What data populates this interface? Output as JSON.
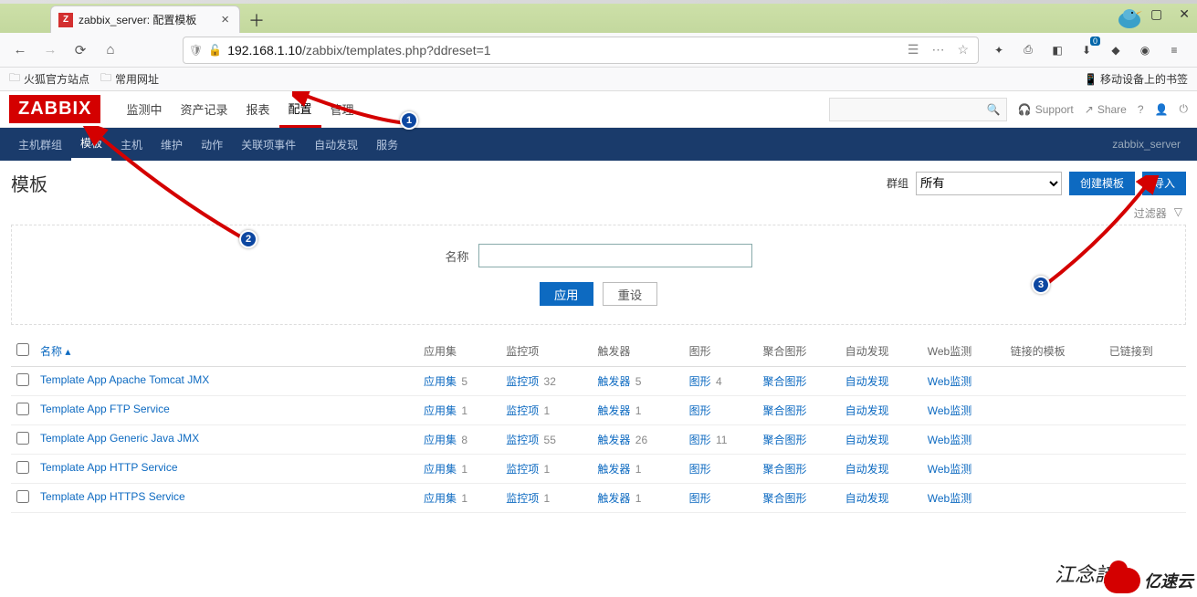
{
  "browser": {
    "tab_title": "zabbix_server: 配置模板",
    "url_display_prefix": "192.168.1.10",
    "url_display_path": "/zabbix/templates.php?ddreset=1",
    "bookmarks": {
      "b1": "火狐官方站点",
      "b2": "常用网址",
      "right": "移动设备上的书签"
    },
    "download_badge": "0"
  },
  "zabbix": {
    "logo": "ZABBIX",
    "main_menu": [
      "监测中",
      "资产记录",
      "报表",
      "配置",
      "管理"
    ],
    "main_menu_active_idx": 3,
    "top_right": {
      "support": "Support",
      "share": "Share"
    },
    "sub_menu": [
      "主机群组",
      "模板",
      "主机",
      "维护",
      "动作",
      "关联项事件",
      "自动发现",
      "服务"
    ],
    "sub_menu_active_idx": 1,
    "breadcrumb": "zabbix_server",
    "page_title": "模板",
    "group_label": "群组",
    "group_selected": "所有",
    "btn_create": "创建模板",
    "btn_import": "导入",
    "filter_toggle": "过滤器",
    "filter": {
      "name_label": "名称",
      "name_value": "",
      "apply": "应用",
      "reset": "重设"
    },
    "columns": {
      "name": "名称",
      "apps": "应用集",
      "items": "监控项",
      "triggers": "触发器",
      "graphs": "图形",
      "screens": "聚合图形",
      "discovery": "自动发现",
      "web": "Web监测",
      "linked_tpl": "链接的模板",
      "linked_to": "已链接到"
    },
    "cell_labels": {
      "apps": "应用集",
      "items": "监控项",
      "triggers": "触发器",
      "graphs": "图形",
      "screens": "聚合图形",
      "discovery": "自动发现",
      "web": "Web监测"
    },
    "rows": [
      {
        "name": "Template App Apache Tomcat JMX",
        "apps": 5,
        "items": 32,
        "triggers": 5,
        "graphs": 4,
        "screens": "聚合图形",
        "discovery": "自动发现",
        "web": "Web监测"
      },
      {
        "name": "Template App FTP Service",
        "apps": 1,
        "items": 1,
        "triggers": 1,
        "graphs": "",
        "screens": "聚合图形",
        "discovery": "自动发现",
        "web": "Web监测"
      },
      {
        "name": "Template App Generic Java JMX",
        "apps": 8,
        "items": 55,
        "triggers": 26,
        "graphs": 11,
        "screens": "聚合图形",
        "discovery": "自动发现",
        "web": "Web监测"
      },
      {
        "name": "Template App HTTP Service",
        "apps": 1,
        "items": 1,
        "triggers": 1,
        "graphs": "",
        "screens": "聚合图形",
        "discovery": "自动发现",
        "web": "Web监测"
      },
      {
        "name": "Template App HTTPS Service",
        "apps": 1,
        "items": 1,
        "triggers": 1,
        "graphs": "",
        "screens": "聚合图形",
        "discovery": "自动发现",
        "web": "Web监测"
      }
    ]
  },
  "annotations": {
    "b1": "1",
    "b2": "2",
    "b3": "3"
  },
  "watermark": {
    "sig": "江念諳",
    "brand": "亿速云"
  }
}
